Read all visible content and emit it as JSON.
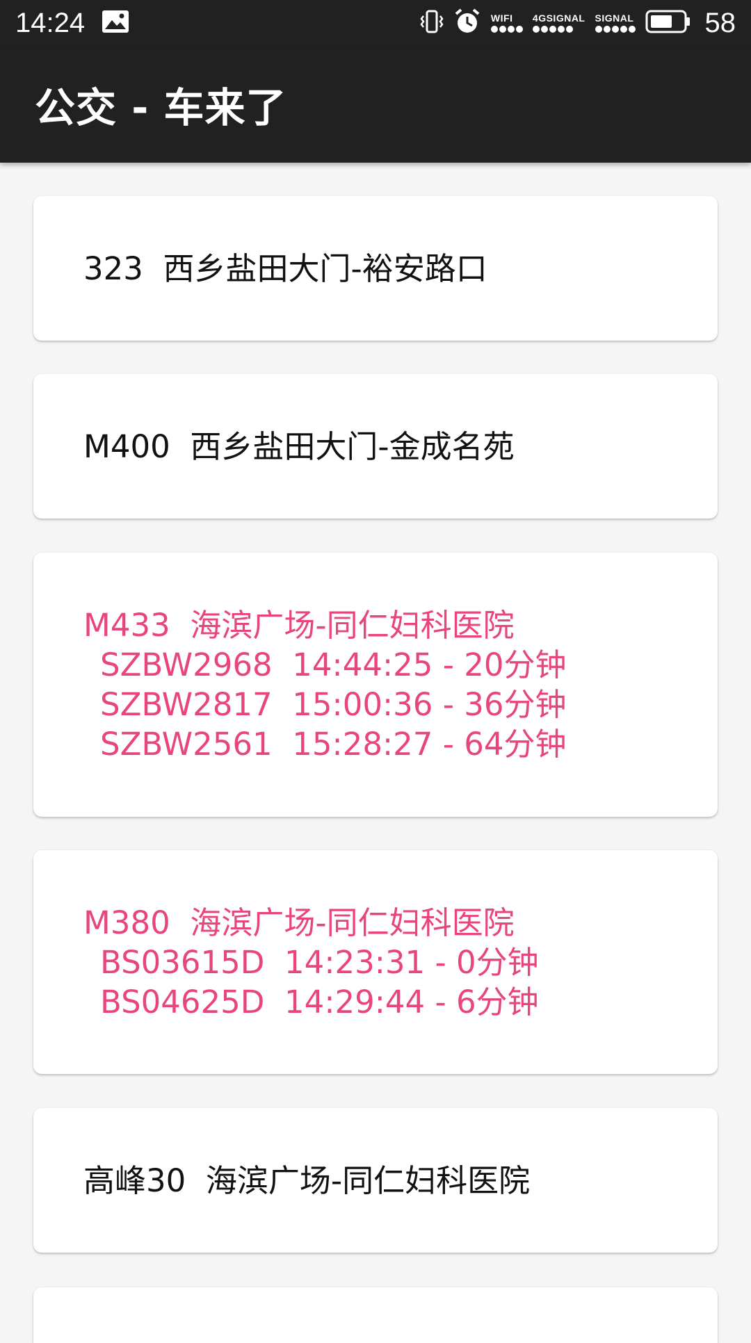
{
  "status_bar": {
    "time": "14:24",
    "wifi_label": "WIFI",
    "signal1_label": "4GSIGNAL",
    "signal2_label": "SIGNAL",
    "battery": "58"
  },
  "app_bar": {
    "title": "公交 - 车来了"
  },
  "colors": {
    "accent": "#e8457d",
    "bar": "#212121",
    "background": "#f5f5f5"
  },
  "routes": [
    {
      "title": "323  西乡盐田大门-裕安路口",
      "buses": []
    },
    {
      "title": "M400  西乡盐田大门-金成名苑",
      "buses": []
    },
    {
      "title": "M433  海滨广场-同仁妇科医院",
      "buses": [
        "SZBW2968  14:44:25 - 20分钟",
        "SZBW2817  15:00:36 - 36分钟",
        "SZBW2561  15:28:27 - 64分钟"
      ]
    },
    {
      "title": "M380  海滨广场-同仁妇科医院",
      "buses": [
        "BS03615D  14:23:31 - 0分钟",
        "BS04625D  14:29:44 - 6分钟"
      ]
    },
    {
      "title": "高峰30  海滨广场-同仁妇科医院",
      "buses": []
    }
  ]
}
